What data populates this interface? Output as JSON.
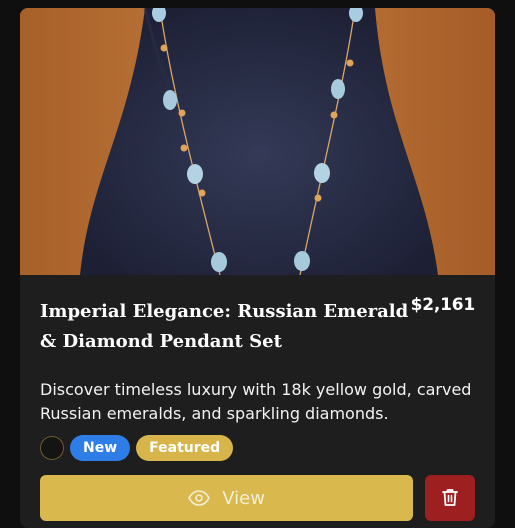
{
  "product": {
    "image_alt": "Necklace displayed on a dark bust",
    "title": "Imperial Elegance: Russian Emerald & Diamond Pendant Set",
    "price": "$2,161",
    "description": "Discover timeless luxury with 18k yellow gold, carved Russian emeralds, and sparkling diamonds.",
    "badges": {
      "new": "New",
      "featured": "Featured"
    }
  },
  "actions": {
    "view_label": "View",
    "view_icon": "eye-icon",
    "delete_icon": "trash-icon"
  },
  "colors": {
    "accent": "#d9b84d",
    "new_badge": "#2f7ee8",
    "delete": "#9e1f1f",
    "card": "#1e1e1e"
  }
}
